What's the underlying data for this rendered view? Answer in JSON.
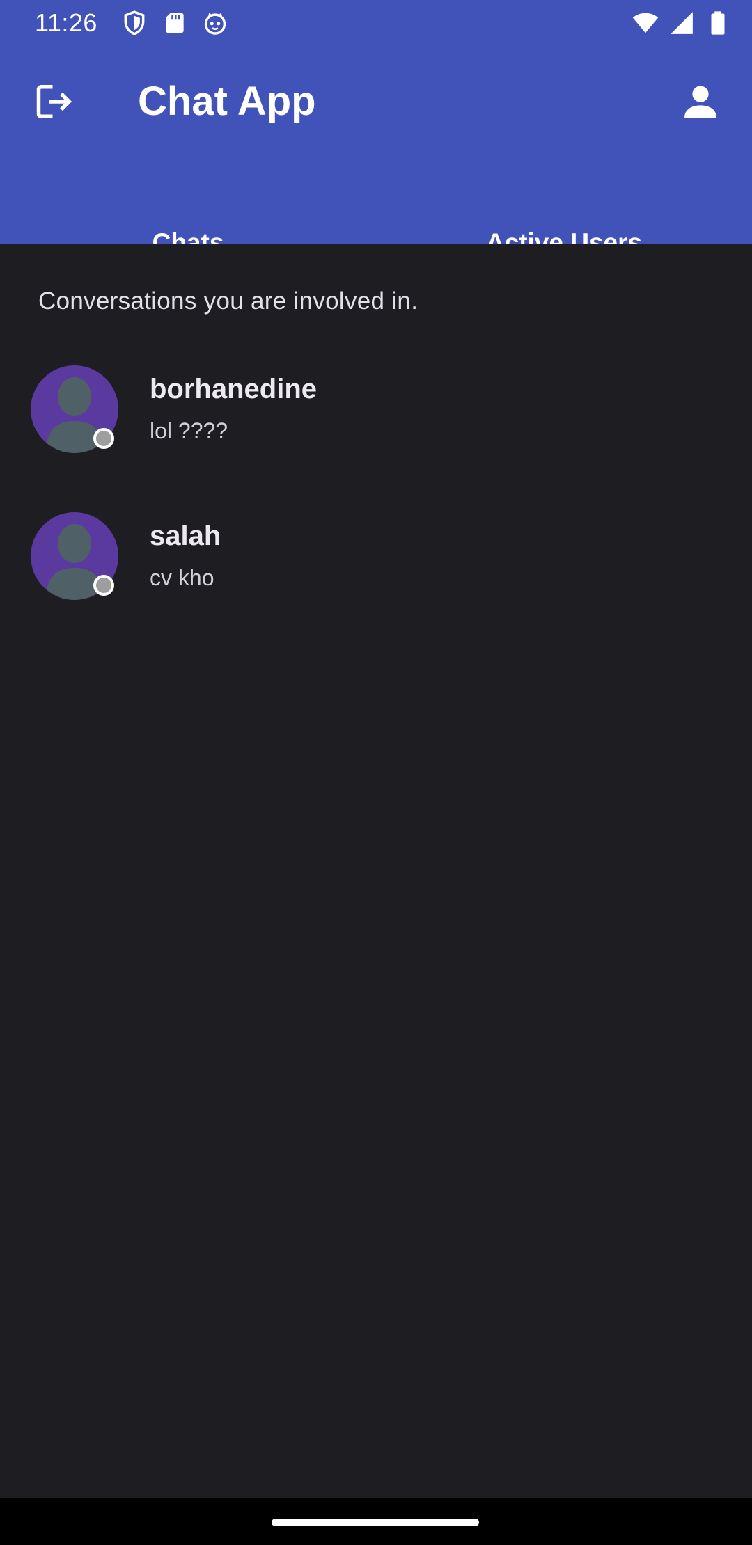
{
  "status_bar": {
    "time": "11:26",
    "left_icons": [
      "shield-icon",
      "sd-card-icon",
      "cat-face-icon"
    ],
    "right_icons": [
      "wifi-icon",
      "cell-signal-icon",
      "battery-icon"
    ]
  },
  "app_bar": {
    "title": "Chat App",
    "left_icon": "logout-icon",
    "right_icon": "account-icon"
  },
  "tabs": [
    {
      "label": "Chats",
      "selected": true
    },
    {
      "label": "Active Users",
      "selected": false
    }
  ],
  "main": {
    "caption": "Conversations you are involved in.",
    "conversations": [
      {
        "name": "borhanedine",
        "last_message": "lol ????",
        "status": "offline"
      },
      {
        "name": "salah",
        "last_message": "cv kho",
        "status": "offline"
      }
    ]
  },
  "colors": {
    "app_bar": "#4153b8",
    "background": "#1e1d22",
    "tab_indicator": "#c8b8f7",
    "avatar_bg": "#5b3aa0",
    "avatar_silhouette": "#4f6066",
    "presence_offline": "#9e9e9e"
  }
}
